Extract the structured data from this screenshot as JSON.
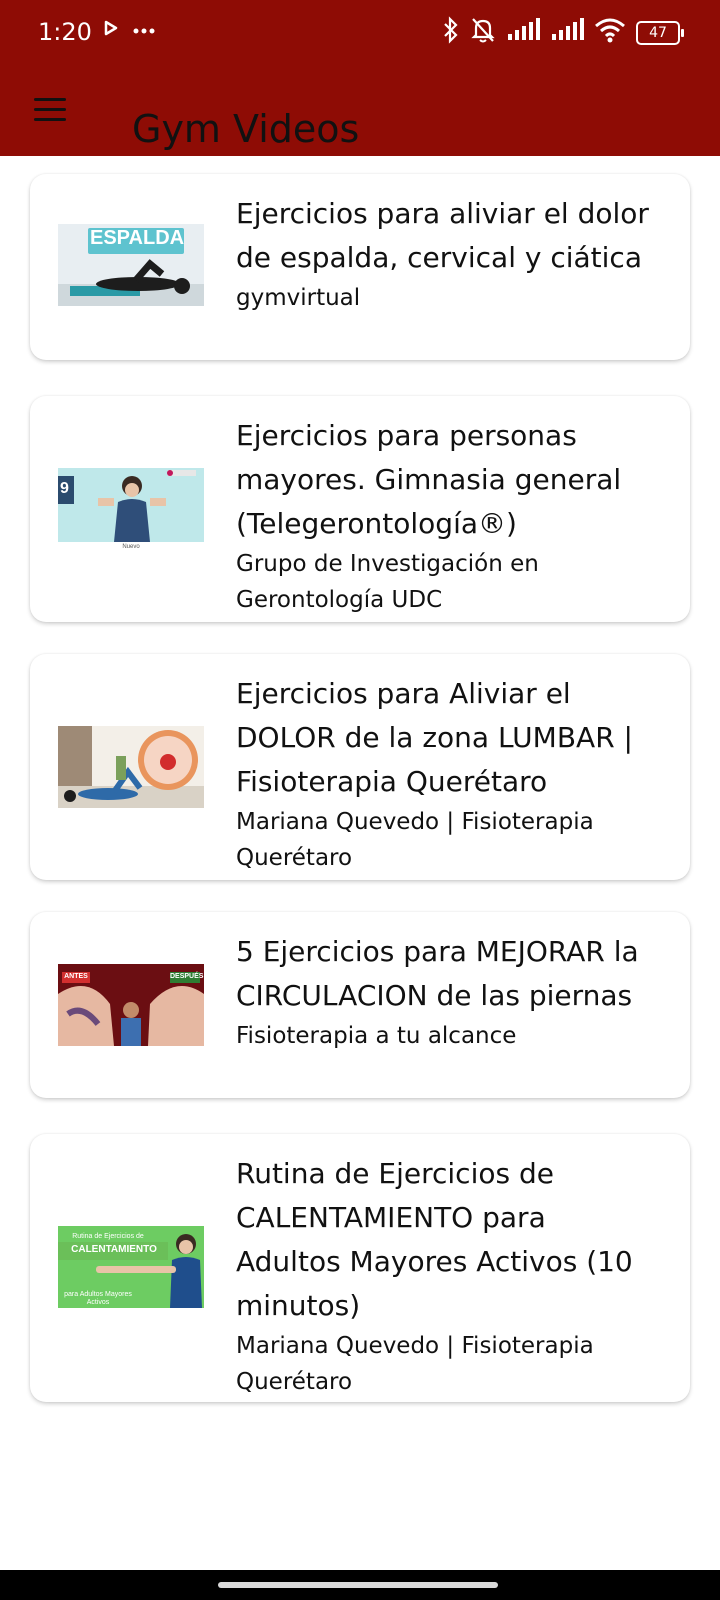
{
  "status_bar": {
    "time": "1:20",
    "battery": "47",
    "icons": [
      "play-icon",
      "more-dots-icon",
      "bluetooth-icon",
      "bell-off-icon",
      "signal-icon",
      "signal-icon",
      "wifi-icon",
      "battery-icon"
    ]
  },
  "app_bar": {
    "title": "Gym Videos",
    "menu_icon": "hamburger-menu-icon",
    "background": "#8e0c05"
  },
  "videos": [
    {
      "title": "Ejercicios para aliviar el dolor de espalda, cervical y ciática",
      "channel": "gymvirtual",
      "thumb_text": "ESPALDA"
    },
    {
      "title": "Ejercicios para personas mayores. Gimnasia general (Telegerontología®)",
      "channel": "Grupo de Investigación en Gerontología UDC",
      "thumb_text": "9"
    },
    {
      "title": "Ejercicios para Aliviar el DOLOR de la zona LUMBAR | Fisioterapia Querétaro",
      "channel": "Mariana Quevedo | Fisioterapia Querétaro"
    },
    {
      "title": "5 Ejercicios para MEJORAR la CIRCULACION de las piernas",
      "channel": "Fisioterapia a tu alcance",
      "thumb_text": "ANTES",
      "thumb_text2": "DESPUÉS"
    },
    {
      "title": "Rutina de Ejercicios de CALENTAMIENTO para Adultos Mayores Activos (10 minutos)",
      "channel": "Mariana Quevedo | Fisioterapia Querétaro",
      "thumb_text": "CALENTAMIENTO"
    }
  ]
}
